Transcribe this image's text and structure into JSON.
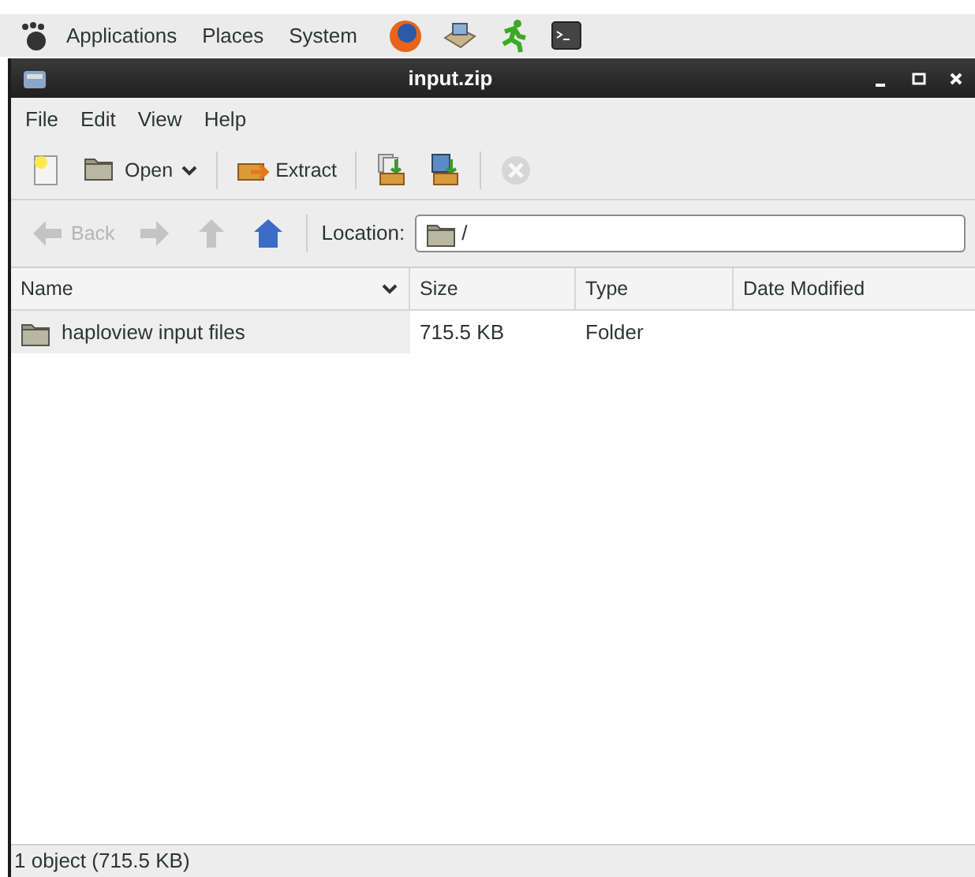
{
  "panel": {
    "menus": [
      "Applications",
      "Places",
      "System"
    ],
    "launchers": [
      {
        "kind": "browser"
      },
      {
        "kind": "installer"
      },
      {
        "kind": "runner"
      },
      {
        "kind": "terminal"
      }
    ]
  },
  "window": {
    "title": "input.zip"
  },
  "menu": [
    "File",
    "Edit",
    "View",
    "Help"
  ],
  "toolbar": [
    {
      "kind": "new",
      "disabled": false
    },
    {
      "kind": "open",
      "label": "Open",
      "dropdown": true,
      "disabled": false
    },
    {
      "kind": "separator"
    },
    {
      "kind": "extract",
      "label": "Extract",
      "disabled": false
    },
    {
      "kind": "separator"
    },
    {
      "kind": "add-files",
      "disabled": false
    },
    {
      "kind": "add-folder",
      "disabled": false
    },
    {
      "kind": "separator"
    },
    {
      "kind": "stop",
      "disabled": true
    }
  ],
  "navigation": [
    {
      "kind": "back",
      "label": "Back",
      "disabled": true
    },
    {
      "kind": "forward",
      "disabled": true
    },
    {
      "kind": "up",
      "disabled": true
    },
    {
      "kind": "home",
      "disabled": false
    }
  ],
  "location": {
    "label": "Location:",
    "value": "/"
  },
  "table": {
    "columns": [
      {
        "label": "Name",
        "sorted": true
      },
      {
        "label": "Size",
        "sorted": false
      },
      {
        "label": "Type",
        "sorted": false
      },
      {
        "label": "Date Modified",
        "sorted": false
      }
    ],
    "rows": [
      {
        "name": "haploview input files",
        "size": "715.5 KB",
        "type": "Folder",
        "selected": false
      }
    ]
  },
  "status_bar": "1 object (715.5 KB)"
}
